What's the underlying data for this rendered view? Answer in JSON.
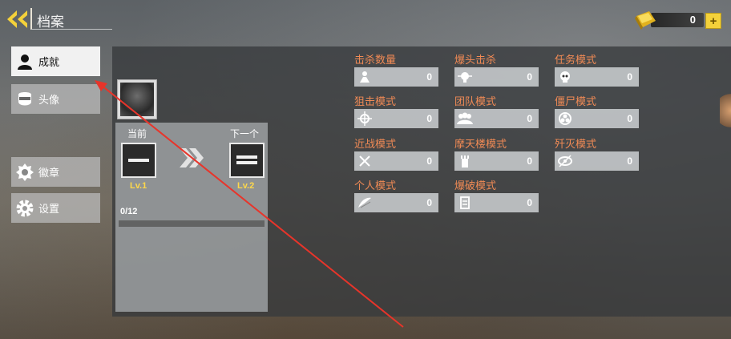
{
  "header": {
    "title": "档案",
    "back_icon": "back-arrow-icon"
  },
  "currency": {
    "icon": "gold-bar-icon",
    "value": "0",
    "add_label": "+"
  },
  "sidebar": {
    "items": [
      {
        "label": "成就",
        "icon": "person-icon",
        "active": true
      },
      {
        "label": "头像",
        "icon": "face-mask-icon",
        "active": false
      },
      {
        "label": "徽章",
        "icon": "badge-icon",
        "active": false
      },
      {
        "label": "设置",
        "icon": "gear-icon",
        "active": false
      }
    ]
  },
  "level": {
    "current_label": "当前",
    "next_label": "下一个",
    "current_level": "Lv.1",
    "next_level": "Lv.2",
    "progress_text": "0/12",
    "progress": 0
  },
  "stats": [
    {
      "title": "击杀数量",
      "value": "0",
      "icon": "kill-icon"
    },
    {
      "title": "爆头击杀",
      "value": "0",
      "icon": "skull-target-icon"
    },
    {
      "title": "任务模式",
      "value": "0",
      "icon": "skull-icon"
    },
    {
      "title": "狙击模式",
      "value": "0",
      "icon": "crosshair-icon"
    },
    {
      "title": "团队模式",
      "value": "0",
      "icon": "team-icon"
    },
    {
      "title": "僵尸模式",
      "value": "0",
      "icon": "biohazard-icon"
    },
    {
      "title": "近战模式",
      "value": "0",
      "icon": "crossed-swords-icon"
    },
    {
      "title": "摩天楼模式",
      "value": "0",
      "icon": "tower-icon"
    },
    {
      "title": "歼灭模式",
      "value": "0",
      "icon": "eye-slash-icon"
    },
    {
      "title": "个人模式",
      "value": "0",
      "icon": "wings-icon"
    },
    {
      "title": "爆破模式",
      "value": "0",
      "icon": "bomb-doc-icon"
    }
  ],
  "colors": {
    "accent_title": "#f08a55",
    "level_yellow": "#ffd84a",
    "annotation_arrow": "#e8342a"
  }
}
